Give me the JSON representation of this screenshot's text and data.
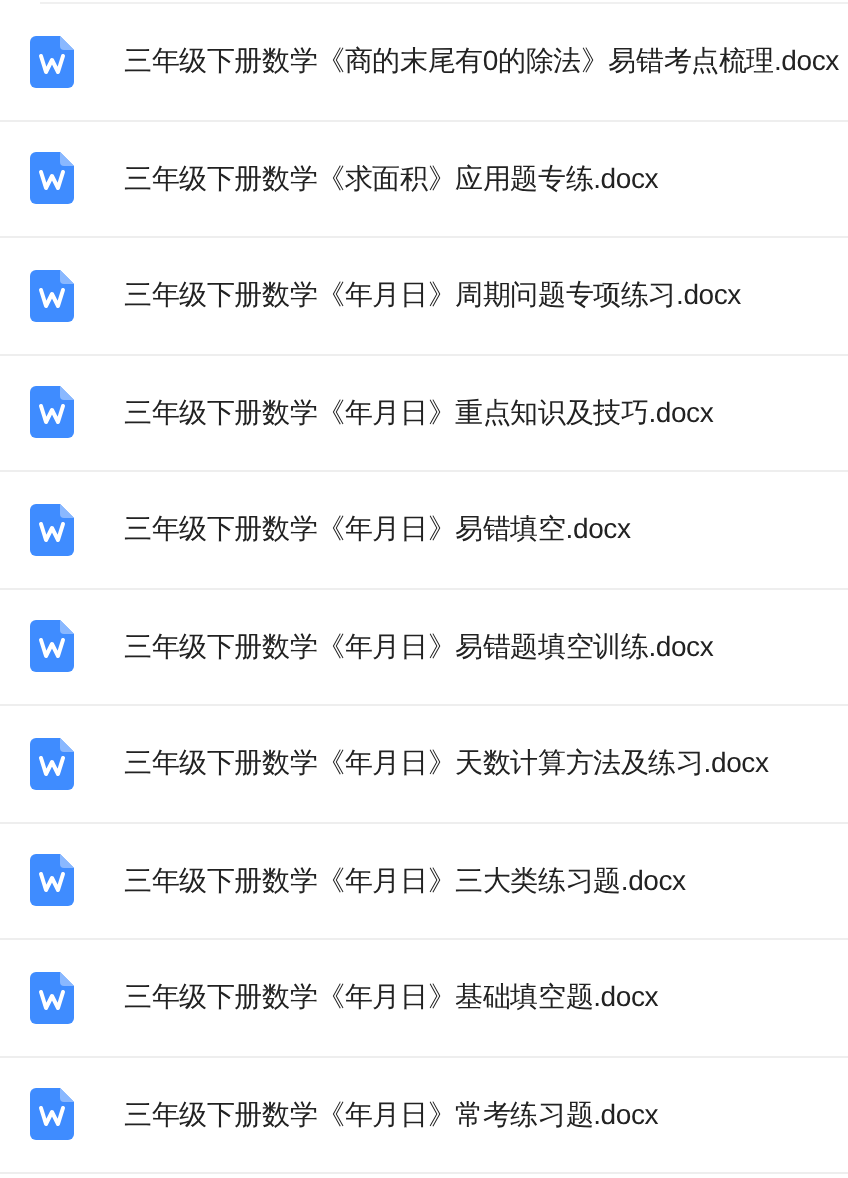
{
  "files": [
    {
      "name": "三年级下册数学《商的末尾有0的除法》易错考点梳理.docx"
    },
    {
      "name": "三年级下册数学《求面积》应用题专练.docx"
    },
    {
      "name": "三年级下册数学《年月日》周期问题专项练习.docx"
    },
    {
      "name": "三年级下册数学《年月日》重点知识及技巧.docx"
    },
    {
      "name": "三年级下册数学《年月日》易错填空.docx"
    },
    {
      "name": "三年级下册数学《年月日》易错题填空训练.docx"
    },
    {
      "name": "三年级下册数学《年月日》天数计算方法及练习.docx"
    },
    {
      "name": "三年级下册数学《年月日》三大类练习题.docx"
    },
    {
      "name": "三年级下册数学《年月日》基础填空题.docx"
    },
    {
      "name": "三年级下册数学《年月日》常考练习题.docx"
    }
  ]
}
